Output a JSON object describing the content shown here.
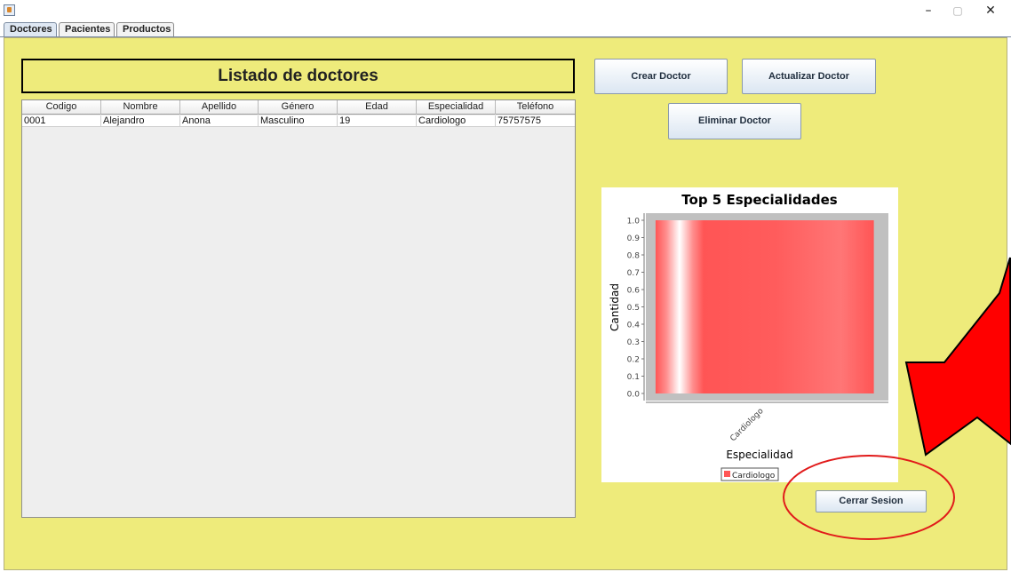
{
  "window": {
    "minimize_label": "–",
    "maximize_label": "▢",
    "close_label": "✕"
  },
  "tabs": [
    {
      "label": "Doctores",
      "active": true
    },
    {
      "label": "Pacientes",
      "active": false
    },
    {
      "label": "Productos",
      "active": false
    }
  ],
  "doctors_panel": {
    "heading": "Listado de doctores",
    "table": {
      "columns": [
        "Codigo",
        "Nombre",
        "Apellido",
        "Género",
        "Edad",
        "Especialidad",
        "Teléfono"
      ],
      "rows": [
        [
          "0001",
          "Alejandro",
          "Anona",
          "Masculino",
          "19",
          "Cardiologo",
          "75757575"
        ]
      ]
    },
    "buttons": {
      "create": "Crear Doctor",
      "update": "Actualizar Doctor",
      "delete": "Eliminar Doctor",
      "logout": "Cerrar Sesion"
    }
  },
  "colors": {
    "panel_background": "#eeeb7b",
    "bar_color": "#ff5555",
    "annotation_red": "#ff0000"
  },
  "chart_data": {
    "type": "bar",
    "title": "Top 5 Especialidades",
    "xlabel": "Especialidad",
    "ylabel": "Cantidad",
    "categories": [
      "Cardiologo"
    ],
    "series": [
      {
        "name": "Cardiologo",
        "values": [
          1.0
        ]
      }
    ],
    "ylim": [
      0,
      1.0
    ],
    "yticks": [
      "0.0",
      "0.1",
      "0.2",
      "0.3",
      "0.4",
      "0.5",
      "0.6",
      "0.7",
      "0.8",
      "0.9",
      "1.0"
    ],
    "legend": "bottom",
    "grid": false
  }
}
